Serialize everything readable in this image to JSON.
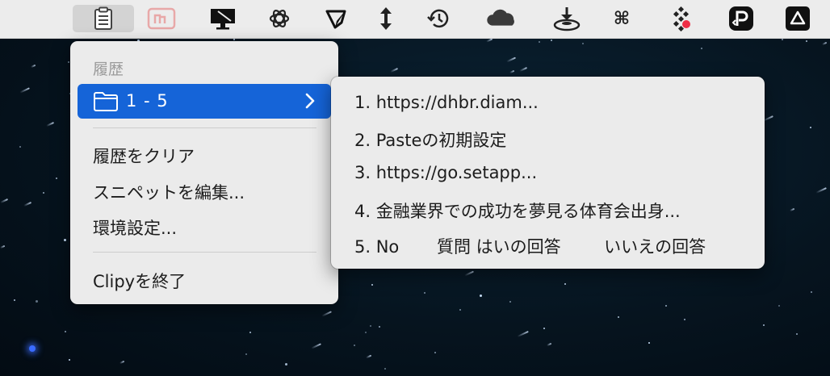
{
  "menubar": {
    "icons": [
      "clipboard-icon",
      "pdf-expert-icon",
      "macbook-icon",
      "chatgpt-icon",
      "flag-icon",
      "updown-arrow-icon",
      "history-clock-icon",
      "onedrive-cloud-icon",
      "download-disk-icon",
      "command-icon",
      "dots-grid-icon",
      "pasteboard-p-icon",
      "drive-triangle-icon"
    ],
    "command_glyph": "⌘"
  },
  "main_menu": {
    "header": "履歴",
    "selected_folder": "1 - 5",
    "clear_history": "履歴をクリア",
    "edit_snippets": "スニペットを編集...",
    "preferences": "環境設定...",
    "quit": "Clipyを終了"
  },
  "sub_menu": {
    "items": [
      "1. https://dhbr.diam...",
      "2. Pasteの初期設定",
      "3. https://go.setapp...",
      "4. 金融業界での成功を夢見る体育会出身...",
      "5. No       質問 はいの回答        いいえの回答"
    ]
  },
  "colors": {
    "selection": "#1564d8",
    "menu_bg": "#ebebeb",
    "menubar_bg": "#ececec"
  }
}
